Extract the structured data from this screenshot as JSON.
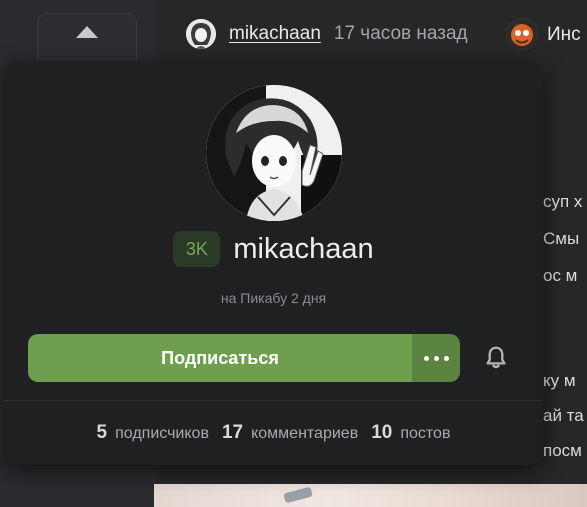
{
  "post_header": {
    "author": "mikachaan",
    "time": "17 часов назад",
    "second_author_partial": "Инс"
  },
  "background_text": [
    "суп х",
    "Смы",
    "ос м",
    "ку м",
    "ай та",
    "посм"
  ],
  "profile_card": {
    "username": "mikachaan",
    "rating": "3K",
    "since": "на Пикабу 2 дня",
    "subscribe_label": "Подписаться",
    "stats": [
      {
        "value": "5",
        "label": "подписчиков"
      },
      {
        "value": "17",
        "label": "комментариев"
      },
      {
        "value": "10",
        "label": "постов"
      }
    ]
  },
  "colors": {
    "accent_green": "#6f9f4e",
    "rating_green": "#77a85a",
    "card_bg": "#1f2022"
  }
}
